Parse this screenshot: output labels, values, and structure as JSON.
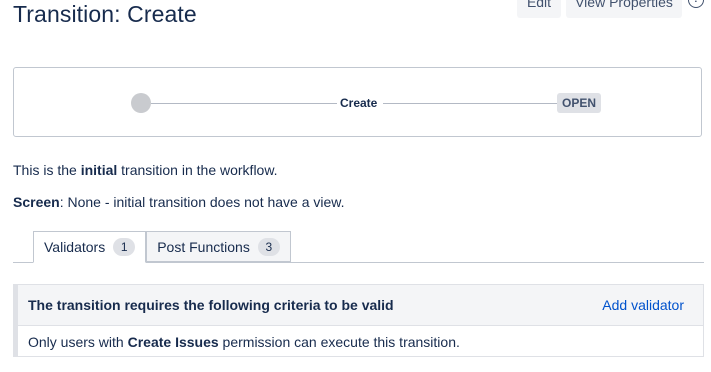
{
  "page": {
    "title": "Transition: Create",
    "edit_label": "Edit",
    "view_properties_label": "View Properties",
    "help_icon": "help-icon"
  },
  "diagram": {
    "transition_name": "Create",
    "target_status": "OPEN"
  },
  "info": {
    "line1_prefix": "This is the ",
    "line1_bold": "initial",
    "line1_suffix": " transition in the workflow.",
    "screen_label": "Screen",
    "screen_value": ": None - initial transition does not have a view."
  },
  "tabs": [
    {
      "label": "Validators",
      "count": "1",
      "active": true
    },
    {
      "label": "Post Functions",
      "count": "3",
      "active": false
    }
  ],
  "validators_panel": {
    "heading": "The transition requires the following criteria to be valid",
    "add_link": "Add validator",
    "rule_prefix": "Only users with ",
    "rule_bold": "Create Issues",
    "rule_suffix": " permission can execute this transition."
  },
  "colors": {
    "link": "#0052cc",
    "text": "#172b4d"
  }
}
